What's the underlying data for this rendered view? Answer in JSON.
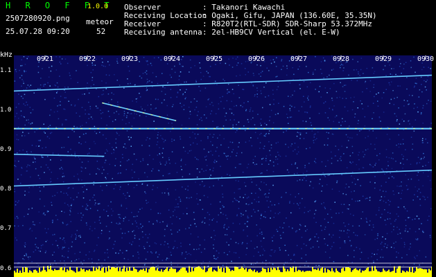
{
  "app": {
    "title": "H R O F F T",
    "version": "1.0.0"
  },
  "file": {
    "name": "2507280920.png",
    "datetime": "25.07.28 09:20"
  },
  "meteor": {
    "label": "meteor",
    "count": "52"
  },
  "info": {
    "labels": [
      "Observer",
      "Receiving Location",
      "Receiver",
      "Receiving antenna"
    ],
    "values": [
      ": Takanori Kawachi",
      ": Ogaki, Gifu, JAPAN (136.60E, 35.35N)",
      ": R820T2(RTL-SDR) SDR-Sharp 53.372MHz",
      ": 2el-HB9CV Vertical (el. E-W)"
    ]
  },
  "chart_data": {
    "type": "heatmap",
    "ylabel": "kHz",
    "x_ticks": [
      "0921",
      "0922",
      "0923",
      "0924",
      "0925",
      "0926",
      "0927",
      "0928",
      "0929",
      "0930"
    ],
    "y_ticks": [
      "1.1",
      "1.0",
      "0.9",
      "0.8",
      "0.7",
      "0.6"
    ],
    "ylim": [
      0.58,
      1.14
    ],
    "traces": [
      {
        "name": "carrier-upper",
        "x_min": [
          0,
          10
        ],
        "y_khz": [
          1.05,
          1.09
        ]
      },
      {
        "name": "meteor-streak",
        "x_min": [
          1.35,
          3.1
        ],
        "y_khz": [
          1.02,
          0.975
        ]
      },
      {
        "name": "carrier-main",
        "x_min": [
          0,
          10
        ],
        "y_khz": [
          0.955,
          0.955
        ]
      },
      {
        "name": "carrier-lower1",
        "x_min": [
          0,
          1.4
        ],
        "y_khz": [
          0.89,
          0.885
        ]
      },
      {
        "name": "carrier-lower2",
        "x_min": [
          0,
          10
        ],
        "y_khz": [
          0.81,
          0.85
        ]
      }
    ],
    "colors": {
      "background": "#0a0a5a",
      "trace": "#66ccff",
      "hot": "#ffff66",
      "baseline": "#ffff00"
    }
  }
}
